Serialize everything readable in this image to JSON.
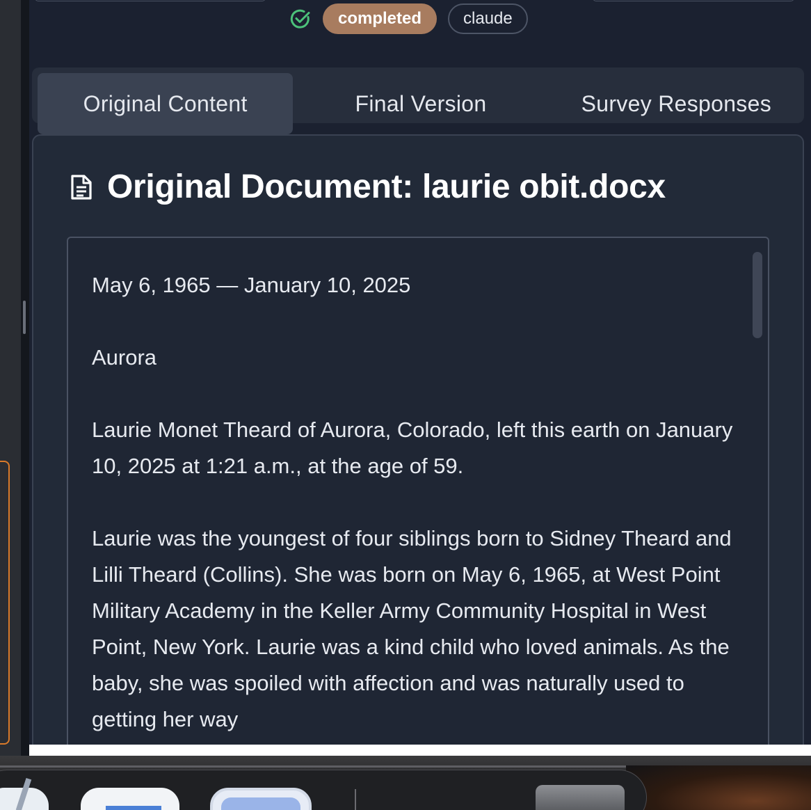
{
  "status": {
    "state_label": "completed",
    "model_label": "claude"
  },
  "tabs": [
    {
      "label": "Original Content",
      "active": true
    },
    {
      "label": "Final Version",
      "active": false
    },
    {
      "label": "Survey Responses",
      "active": false
    }
  ],
  "document": {
    "title": "Original Document: laurie obit.docx",
    "paragraphs": [
      "May 6, 1965 — January 10, 2025",
      "Aurora",
      "Laurie Monet Theard of Aurora, Colorado, left this earth on January 10, 2025 at 1:21 a.m., at the age of 59.",
      "Laurie was the youngest of four siblings born to Sidney Theard and Lilli Theard (Collins). She was born on May 6, 1965, at West Point Military Academy in the Keller Army Community Hospital in West Point, New York. Laurie was a kind child who loved animals. As the baby, she was spoiled with affection and was naturally used to getting her way"
    ]
  },
  "colors": {
    "accent_badge": "#a87c5f",
    "success_icon": "#4cc27a",
    "background": "#1b2130"
  },
  "icons": {
    "status": "check-circle-icon",
    "document": "document-icon"
  }
}
